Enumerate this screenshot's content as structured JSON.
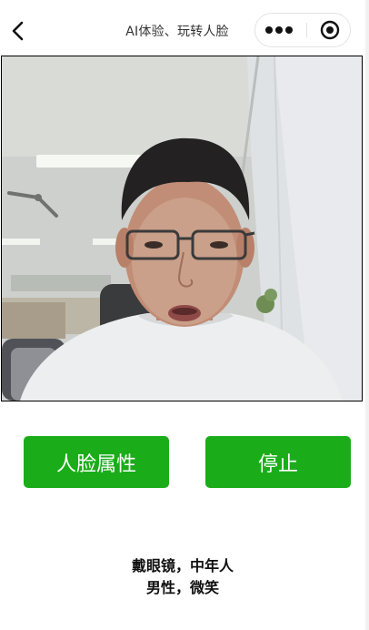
{
  "navbar": {
    "title": "AI体验、玩转人脸",
    "back_icon": "chevron-left-icon",
    "more_icon": "more-dots-icon",
    "close_icon": "target-circle-icon"
  },
  "camera": {
    "description_icon": "camera-preview"
  },
  "buttons": {
    "face_attr_label": "人脸属性",
    "stop_label": "停止",
    "color": "#1aad19"
  },
  "result": {
    "line1": "戴眼镜，中年人",
    "line2": "男性，微笑"
  }
}
